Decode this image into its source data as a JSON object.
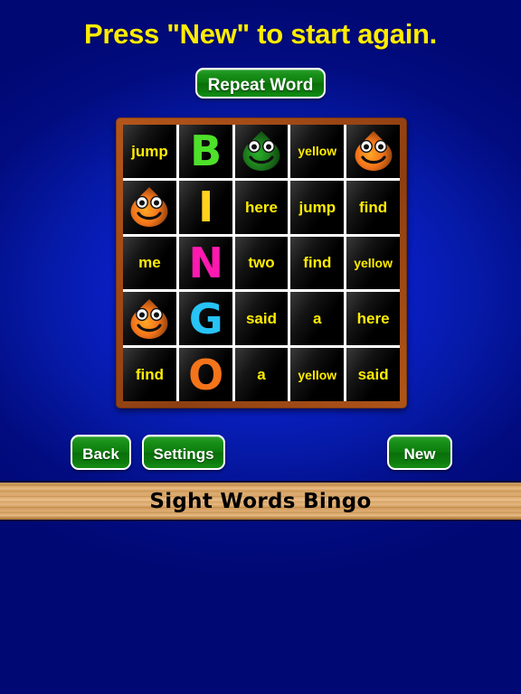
{
  "header": {
    "message": "Press \"New\" to start again."
  },
  "toolbar": {
    "repeat_word_label": "Repeat Word"
  },
  "board": {
    "frame_color": "#9a4514",
    "cell_bg_color": "#000000",
    "word_color": "#ffec00",
    "rows": [
      [
        {
          "kind": "word",
          "text": "jump"
        },
        {
          "kind": "letter",
          "text": "B",
          "color": "#4ee02a"
        },
        {
          "kind": "blob",
          "text": "",
          "color": "#1c7a1c"
        },
        {
          "kind": "word",
          "text": "yellow"
        },
        {
          "kind": "blob",
          "text": "",
          "color": "#f4741a"
        }
      ],
      [
        {
          "kind": "blob",
          "text": "",
          "color": "#f4741a"
        },
        {
          "kind": "letter",
          "text": "I",
          "color": "#ffd21e"
        },
        {
          "kind": "word",
          "text": "here"
        },
        {
          "kind": "word",
          "text": "jump"
        },
        {
          "kind": "word",
          "text": "find"
        }
      ],
      [
        {
          "kind": "word",
          "text": "me"
        },
        {
          "kind": "letter",
          "text": "N",
          "color": "#ff19b0"
        },
        {
          "kind": "word",
          "text": "two"
        },
        {
          "kind": "word",
          "text": "find"
        },
        {
          "kind": "word",
          "text": "yellow"
        }
      ],
      [
        {
          "kind": "blob",
          "text": "",
          "color": "#f4741a"
        },
        {
          "kind": "letter",
          "text": "G",
          "color": "#27c3f5"
        },
        {
          "kind": "word",
          "text": "said"
        },
        {
          "kind": "word",
          "text": "a"
        },
        {
          "kind": "word",
          "text": "here"
        }
      ],
      [
        {
          "kind": "word",
          "text": "find"
        },
        {
          "kind": "letter",
          "text": "O",
          "color": "#f4741a"
        },
        {
          "kind": "word",
          "text": "a"
        },
        {
          "kind": "word",
          "text": "yellow"
        },
        {
          "kind": "word",
          "text": "said"
        }
      ]
    ]
  },
  "controls": {
    "back_label": "Back",
    "settings_label": "Settings",
    "new_label": "New"
  },
  "title_bar": {
    "text": "Sight Words Bingo"
  }
}
